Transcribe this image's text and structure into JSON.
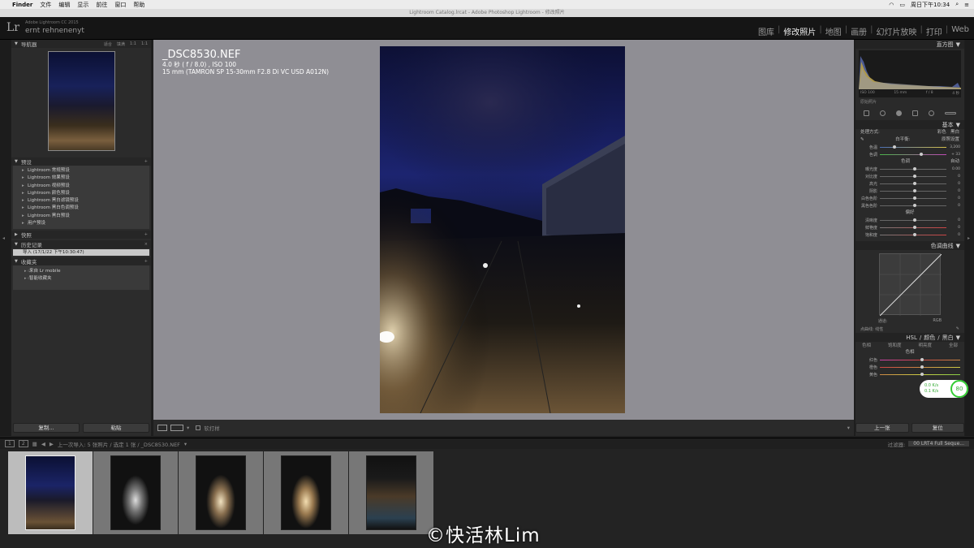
{
  "menubar": {
    "apple": "",
    "items": [
      "Finder",
      "文件",
      "编辑",
      "显示",
      "前往",
      "窗口",
      "帮助"
    ],
    "clock": "周日下午10:34"
  },
  "window_title": "Lightroom Catalog.lrcat - Adobe Photoshop Lightroom - 修改照片",
  "identity": {
    "logo": "Lr",
    "product": "Adobe Lightroom CC 2015",
    "user": "ernt rehnenenyt"
  },
  "modules": [
    "图库",
    "修改照片",
    "地图",
    "画册",
    "幻灯片放映",
    "打印",
    "Web"
  ],
  "active_module": "修改照片",
  "left_panel": {
    "navigator": {
      "title": "导航器",
      "opts": [
        "适合",
        "填满",
        "1:1",
        "1:1"
      ]
    },
    "presets": {
      "title": "预设",
      "items": [
        "Lightroom 常规预设",
        "Lightroom 效果预设",
        "Lightroom 视频预设",
        "Lightroom 颜色预设",
        "Lightroom 黑白滤镜预设",
        "Lightroom 黑白色调预设",
        "Lightroom 黑白预设",
        "用户预设"
      ]
    },
    "snapshots": {
      "title": "快照"
    },
    "history": {
      "title": "历史记录",
      "item": "导入 (17/1/22 下午10:30:47)"
    },
    "collections": {
      "title": "收藏夹",
      "items": [
        "来自 Lr mobile",
        "智能收藏夹"
      ]
    },
    "buttons": {
      "copy": "复制...",
      "paste": "粘贴"
    }
  },
  "photo_info": {
    "filename": "_DSC8530.NEF",
    "exposure": "4.0 秒 ( f / 8.0) , ISO 100",
    "lens": "15 mm (TAMRON SP 15-30mm F2.8 Di VC USD A012N)"
  },
  "toolbar": {
    "soft_proof": "软打样"
  },
  "right_panel": {
    "histogram": {
      "title": "直方图",
      "iso": "ISO 100",
      "focal": "15 mm",
      "aperture": "f / 8",
      "shutter": "4 秒",
      "original": "原始照片"
    },
    "basic": {
      "title": "基本",
      "treatment_label": "处理方式:",
      "color": "彩色",
      "bw": "黑白",
      "wb_label": "白平衡:",
      "wb_value": "原照设置",
      "temp_label": "色温",
      "temp_value": "3,200",
      "tint_label": "色调",
      "tint_value": "+ 33",
      "tone": "色调",
      "tone_auto": "自动",
      "exposure_label": "曝光度",
      "exposure_value": "0.00",
      "contrast_label": "对比度",
      "contrast_value": "0",
      "highlights_label": "高光",
      "highlights_value": "0",
      "shadows_label": "阴影",
      "shadows_value": "0",
      "whites_label": "白色色阶",
      "whites_value": "0",
      "blacks_label": "黑色色阶",
      "blacks_value": "0",
      "presence": "偏好",
      "clarity_label": "清晰度",
      "clarity_value": "0",
      "vibrance_label": "鲜艳度",
      "vibrance_value": "0",
      "saturation_label": "饱和度",
      "saturation_value": "0"
    },
    "tone_curve": {
      "title": "色调曲线",
      "region": "通道:",
      "channel": "RGB",
      "point_label": "点曲线:",
      "point_value": "线性"
    },
    "hsl": {
      "title_hsl": "HSL",
      "title_color": "颜色",
      "title_bw": "黑白",
      "tabs": [
        "色相",
        "饱和度",
        "明亮度",
        "全部"
      ],
      "section": "色相",
      "rows": [
        "红色",
        "橙色",
        "黄色"
      ]
    },
    "buttons": {
      "prev": "上一张",
      "reset": "复位"
    }
  },
  "filmstrip_bar": {
    "page1": "1",
    "page2": "2",
    "source": "上一次导入: 5 张照片 / 选定 1 张 / _DSC8530.NEF",
    "filter_label": "过滤器:",
    "filter_value": "00 LRT4 Full Seque..."
  },
  "floating_badge": {
    "up": "0.0 K/s",
    "down": "0.1 K/s",
    "percent": "80"
  },
  "watermark": "©快活林Lim"
}
